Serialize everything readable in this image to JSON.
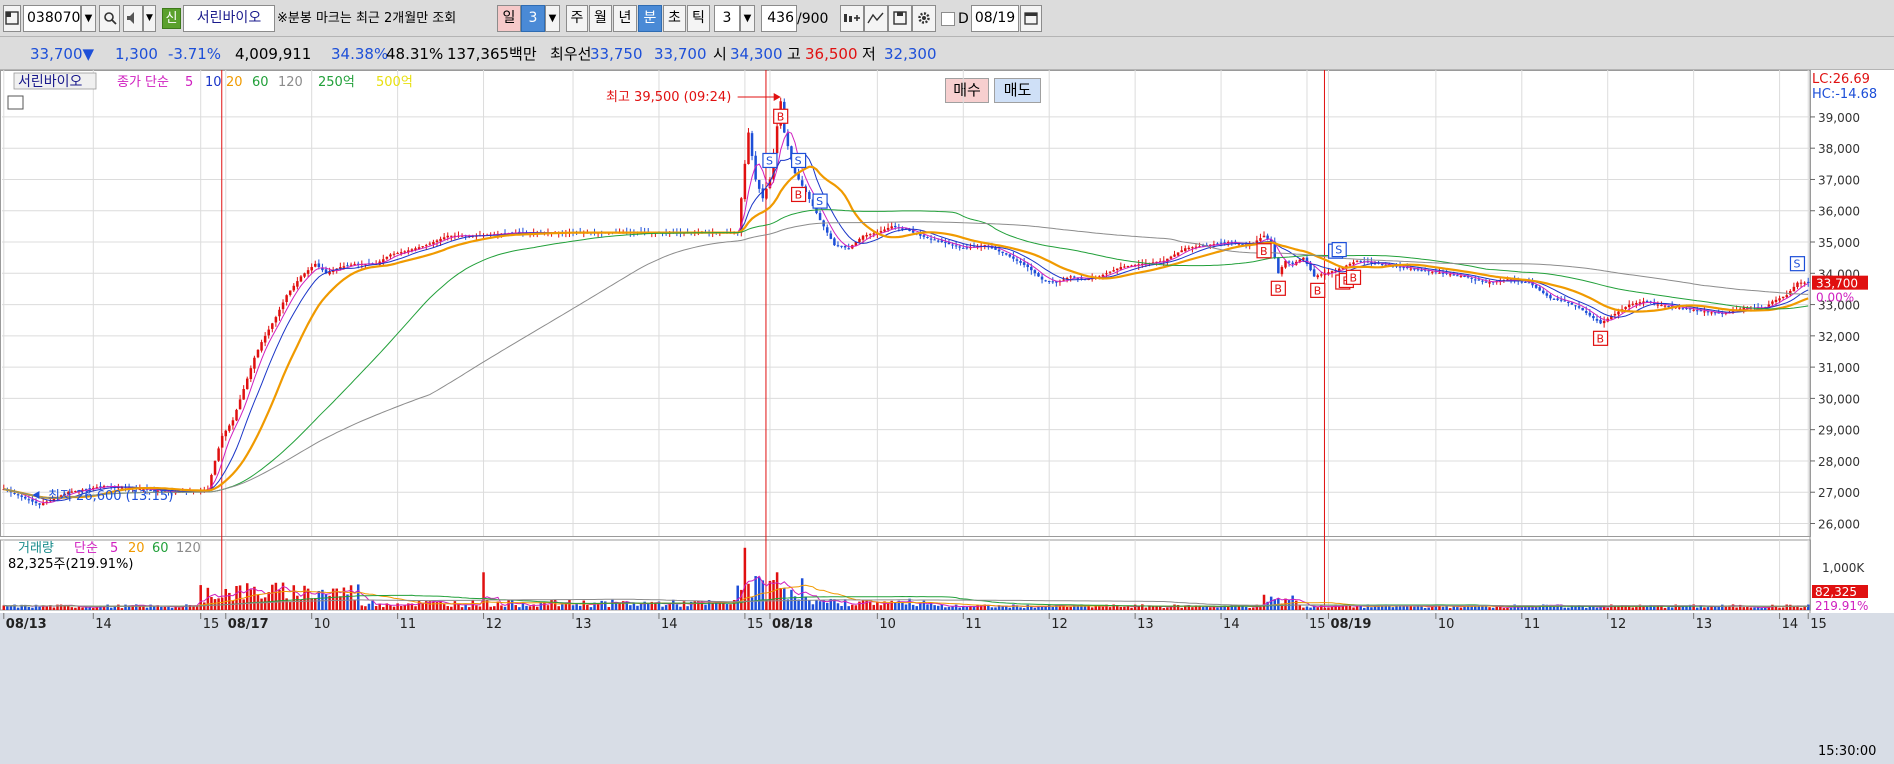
{
  "toolbar": {
    "code": "038070",
    "sin_badge": "신",
    "stock_name": "서린바이오",
    "notice": "※분봉 마크는 최근 2개월만 조회",
    "period_day": "일",
    "period_num": "3",
    "period_week": "주",
    "period_month": "월",
    "period_year": "년",
    "period_minute": "분",
    "period_second": "초",
    "period_tick": "틱",
    "interval_value": "3",
    "count_value": "436",
    "count_total": "/900",
    "date_checkbox_label": "D",
    "date_value": "08/19"
  },
  "infobar": {
    "price": "33,700",
    "change_arrow": "▼",
    "change": "1,300",
    "change_pct": "-3.71%",
    "volume": "4,009,911",
    "pct1": "34.38%",
    "pct2": "48.31%",
    "amount": "137,365백만",
    "best_label": "최우선",
    "best_ask": "33,750",
    "best_bid": "33,700",
    "open_label": "시",
    "open": "34,300",
    "high_label": "고",
    "high": "36,500",
    "low_label": "저",
    "low": "32,300",
    "buy_label": "매수",
    "sell_label": "매도"
  },
  "chart_data": {
    "type": "candlestick",
    "legend_price": {
      "name": "서린바이오",
      "ma_label": "종가 단순",
      "periods": [
        "5",
        "10",
        "20",
        "60",
        "120"
      ],
      "extra": [
        "250억",
        "500억"
      ]
    },
    "legend_volume": {
      "name": "거래량",
      "ma_label": "단순",
      "periods": [
        "5",
        "20",
        "60",
        "120"
      ],
      "current": "82,325주(219.91%)"
    },
    "annotation_high": "최고 39,500 (09:24)",
    "annotation_low": "최저 26,600 (13:15)",
    "lc": "LC:26.69",
    "hc": "HC:-14.68",
    "current_price": "33,700",
    "current_pct": "0.00%",
    "volume_current": "82,325",
    "volume_pct": "219.91%",
    "volume_axis_label": "1,000K",
    "time_label": "15:30:00",
    "y_ticks": [
      "39,000",
      "38,000",
      "37,000",
      "36,000",
      "35,000",
      "34,000",
      "33,000",
      "32,000",
      "31,000",
      "30,000",
      "29,000",
      "28,000",
      "27,000",
      "26,000"
    ],
    "x_labels": [
      "08/13",
      "14",
      "15",
      "08/17",
      "10",
      "11",
      "12",
      "13",
      "14",
      "15",
      "08/18",
      "10",
      "11",
      "12",
      "13",
      "14",
      "15",
      "08/19",
      "10",
      "11",
      "12",
      "13",
      "14",
      "15"
    ],
    "price_path_points": [
      [
        0,
        27.1
      ],
      [
        6,
        26.8
      ],
      [
        10,
        26.6
      ],
      [
        18,
        27.0
      ],
      [
        28,
        27.2
      ],
      [
        38,
        27.1
      ],
      [
        48,
        27.0
      ],
      [
        57,
        27.1
      ],
      [
        59,
        28.0
      ],
      [
        61,
        28.8
      ],
      [
        64,
        29.3
      ],
      [
        67,
        30.3
      ],
      [
        70,
        31.3
      ],
      [
        72,
        31.8
      ],
      [
        76,
        32.6
      ],
      [
        79,
        33.3
      ],
      [
        83,
        33.9
      ],
      [
        87,
        34.3
      ],
      [
        90,
        34.0
      ],
      [
        94,
        34.2
      ],
      [
        98,
        34.3
      ],
      [
        104,
        34.3
      ],
      [
        108,
        34.6
      ],
      [
        112,
        34.7
      ],
      [
        118,
        34.9
      ],
      [
        124,
        35.2
      ],
      [
        132,
        35.2
      ],
      [
        142,
        35.3
      ],
      [
        154,
        35.3
      ],
      [
        168,
        35.3
      ],
      [
        183,
        35.3
      ],
      [
        205,
        35.3
      ],
      [
        207,
        37.5
      ],
      [
        208,
        38.5
      ],
      [
        210,
        37.0
      ],
      [
        212,
        36.4
      ],
      [
        214,
        37.0
      ],
      [
        216,
        38.7
      ],
      [
        217,
        39.5
      ],
      [
        218,
        38.5
      ],
      [
        221,
        37.2
      ],
      [
        224,
        36.6
      ],
      [
        228,
        35.7
      ],
      [
        232,
        34.9
      ],
      [
        236,
        34.8
      ],
      [
        240,
        35.2
      ],
      [
        244,
        35.3
      ],
      [
        248,
        35.5
      ],
      [
        252,
        35.4
      ],
      [
        256,
        35.2
      ],
      [
        262,
        35.0
      ],
      [
        268,
        34.8
      ],
      [
        274,
        34.9
      ],
      [
        280,
        34.6
      ],
      [
        286,
        34.2
      ],
      [
        290,
        33.8
      ],
      [
        294,
        33.7
      ],
      [
        298,
        33.9
      ],
      [
        302,
        33.8
      ],
      [
        306,
        33.9
      ],
      [
        312,
        34.2
      ],
      [
        318,
        34.3
      ],
      [
        324,
        34.4
      ],
      [
        330,
        34.8
      ],
      [
        336,
        34.9
      ],
      [
        342,
        35.0
      ],
      [
        348,
        34.9
      ],
      [
        352,
        35.2
      ],
      [
        354,
        35.0
      ],
      [
        356,
        34.0
      ],
      [
        358,
        34.4
      ],
      [
        360,
        34.3
      ],
      [
        363,
        34.5
      ],
      [
        366,
        33.9
      ],
      [
        369,
        34.0
      ],
      [
        372,
        34.1
      ],
      [
        378,
        34.4
      ],
      [
        384,
        34.3
      ],
      [
        390,
        34.2
      ],
      [
        396,
        34.1
      ],
      [
        402,
        34.0
      ],
      [
        408,
        33.9
      ],
      [
        414,
        33.7
      ],
      [
        420,
        33.8
      ],
      [
        426,
        33.7
      ],
      [
        432,
        33.2
      ],
      [
        436,
        33.1
      ],
      [
        440,
        32.9
      ],
      [
        446,
        32.4
      ],
      [
        450,
        32.7
      ],
      [
        454,
        33.0
      ],
      [
        458,
        33.1
      ],
      [
        462,
        33.0
      ],
      [
        468,
        32.9
      ],
      [
        474,
        32.8
      ],
      [
        480,
        32.7
      ],
      [
        486,
        32.9
      ],
      [
        492,
        32.9
      ],
      [
        494,
        33.1
      ],
      [
        498,
        33.3
      ],
      [
        501,
        33.7
      ],
      [
        504,
        33.7
      ]
    ]
  },
  "colors": {
    "up": "#e01010",
    "down": "#1d4fd8",
    "ma5": "#d020c0",
    "ma10": "#1a35c8",
    "ma20": "#f09a00",
    "ma60": "#22a03a",
    "ma120": "#8c8c8c",
    "grid": "#dcdcdc",
    "separator": "#e01010"
  }
}
